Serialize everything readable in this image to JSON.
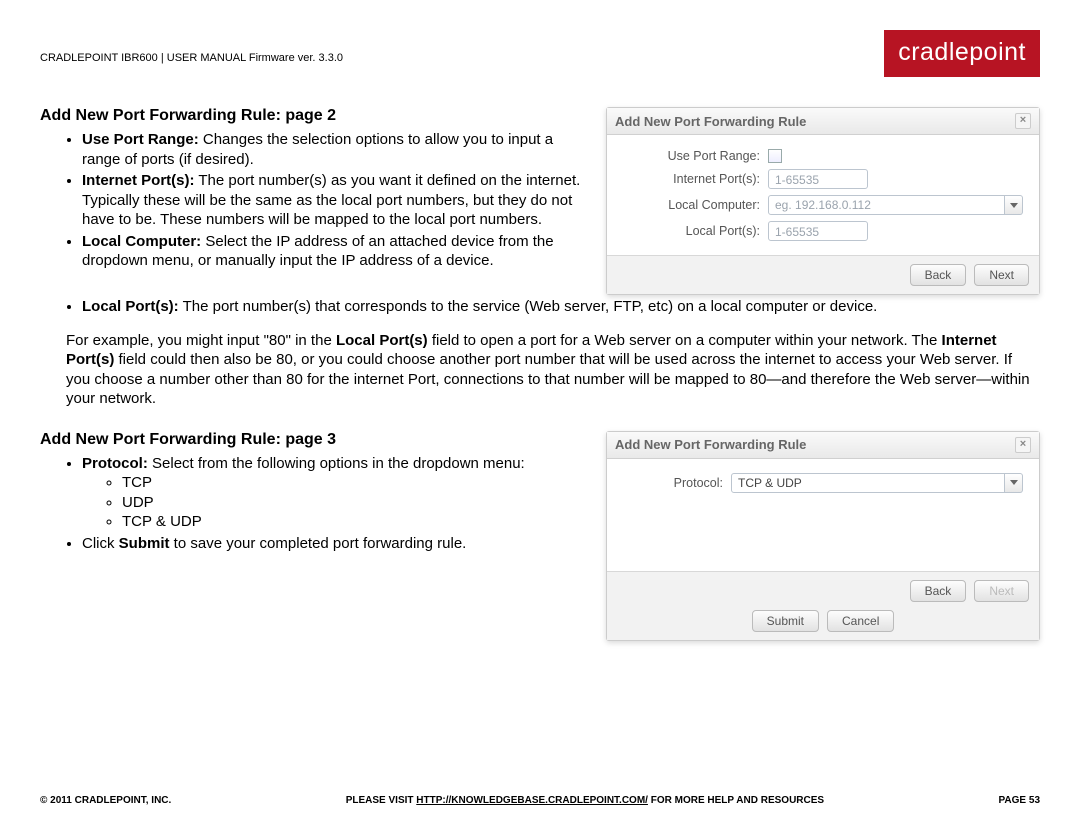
{
  "header": {
    "doc_line": "CRADLEPOINT IBR600 | USER MANUAL Firmware ver. 3.3.0",
    "logo": "cradlepoint"
  },
  "section1": {
    "heading": "Add New Port Forwarding Rule: page 2",
    "bullets": {
      "b1_label": "Use Port Range:",
      "b1_text": " Changes the selection options to allow you to input a range of ports (if desired).",
      "b2_label": "Internet Port(s):",
      "b2_text": " The port number(s) as you want it defined on the internet. Typically these will be the same as the local port numbers, but they do not have to be. These numbers will be mapped to the local port numbers.",
      "b3_label": "Local Computer:",
      "b3_text": " Select the IP address of an attached device from the dropdown menu, or manually input the IP address of a device.",
      "b4_label": "Local Port(s):",
      "b4_text": " The port number(s) that corresponds to the service (Web server, FTP, etc) on a local computer or device."
    },
    "example_pre": "For example, you might input \"80\" in the ",
    "example_lp": "Local Port(s)",
    "example_mid": " field to open a port for a Web server on a computer within your network. The ",
    "example_ip": "Internet Port(s)",
    "example_post": " field could then also be 80, or you could choose another port number that will be used across the internet to access your Web server. If you choose a number other than 80 for the internet Port, connections to that number will be mapped to 80—and therefore the Web server—within your network."
  },
  "dialog1": {
    "title": "Add New Port Forwarding Rule",
    "labels": {
      "use_port_range": "Use Port Range:",
      "internet_ports": "Internet Port(s):",
      "local_computer": "Local Computer:",
      "local_ports": "Local Port(s):"
    },
    "placeholders": {
      "internet_ports": "1-65535",
      "local_computer": "eg. 192.168.0.112",
      "local_ports": "1-65535"
    },
    "buttons": {
      "back": "Back",
      "next": "Next"
    }
  },
  "section2": {
    "heading": "Add New Port Forwarding Rule: page 3",
    "b1_label": "Protocol:",
    "b1_text": " Select from the following options in the dropdown menu:",
    "opts": {
      "o1": "TCP",
      "o2": "UDP",
      "o3": "TCP & UDP"
    },
    "b2_pre": "Click ",
    "b2_bold": "Submit",
    "b2_post": " to save your completed port forwarding rule."
  },
  "dialog2": {
    "title": "Add New Port Forwarding Rule",
    "protocol_label": "Protocol:",
    "protocol_value": "TCP & UDP",
    "buttons": {
      "back": "Back",
      "next": "Next",
      "submit": "Submit",
      "cancel": "Cancel"
    }
  },
  "footer": {
    "left": "© 2011 CRADLEPOINT, INC.",
    "mid_pre": "PLEASE VISIT ",
    "mid_link": "HTTP://KNOWLEDGEBASE.CRADLEPOINT.COM/",
    "mid_post": " FOR MORE HELP AND RESOURCES",
    "right": "PAGE 53"
  }
}
